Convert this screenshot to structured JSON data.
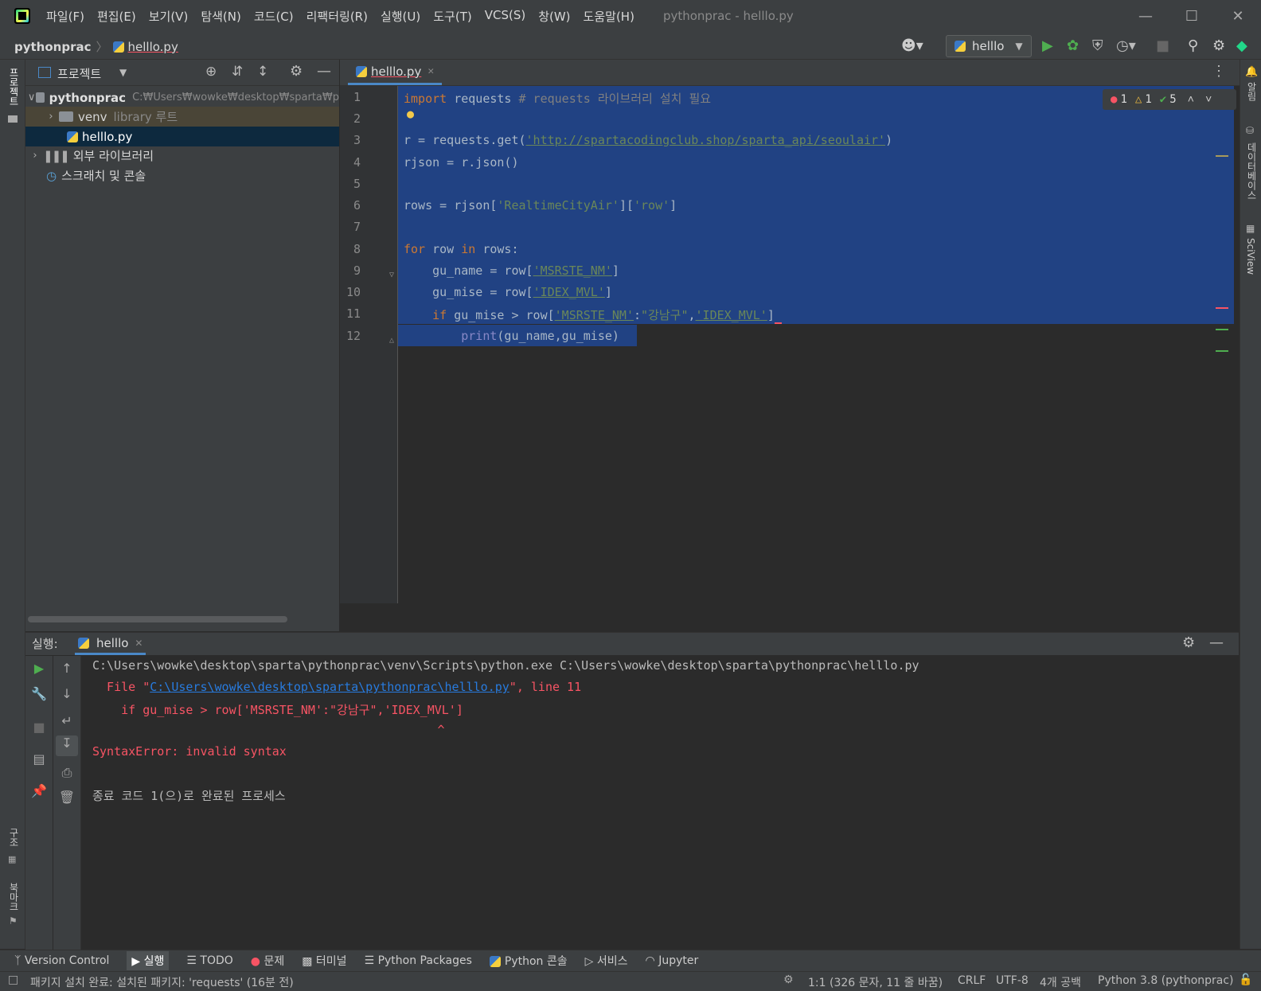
{
  "menu": [
    "파일(F)",
    "편집(E)",
    "보기(V)",
    "탐색(N)",
    "코드(C)",
    "리팩터링(R)",
    "실행(U)",
    "도구(T)",
    "VCS(S)",
    "창(W)",
    "도움말(H)"
  ],
  "window_title": "pythonprac - helllo.py",
  "breadcrumb": {
    "project": "pythonprac",
    "file": "helllo.py"
  },
  "run_config": "helllo",
  "left_stripe": {
    "project": "프로젝트",
    "structure": "구조",
    "bookmarks": "북마크"
  },
  "right_stripe": {
    "notifications": "알림",
    "database": "데이터베이스",
    "sciview": "SciView"
  },
  "project_panel": {
    "title": "프로젝트",
    "root_name": "pythonprac",
    "root_path": "C:₩Users₩wowke₩desktop₩sparta₩p",
    "venv": "venv",
    "venv_note": "library 루트",
    "file": "helllo.py",
    "external": "외부 라이브러리",
    "scratch": "스크래치 및 콘솔"
  },
  "editor": {
    "tab": "helllo.py",
    "line_numbers": [
      "1",
      "2",
      "3",
      "4",
      "5",
      "6",
      "7",
      "8",
      "9",
      "10",
      "11",
      "12"
    ],
    "inspection": {
      "errors": "1",
      "warnings": "1",
      "ok": "5"
    },
    "code": {
      "l1_kw": "import",
      "l1_mod": " requests ",
      "l1_comment": "# requests 라이브러리 설치 필요",
      "l3_a": "r = requests.get(",
      "l3_url": "'http://spartacodingclub.shop/sparta_api/seoulair'",
      "l3_b": ")",
      "l4": "rjson = r.json()",
      "l6_a": "rows = rjson[",
      "l6_s1": "'RealtimeCityAir'",
      "l6_b": "][",
      "l6_s2": "'row'",
      "l6_c": "]",
      "l8_kw1": "for",
      "l8_a": " row ",
      "l8_kw2": "in",
      "l8_b": " rows:",
      "l9_a": "    gu_name = row[",
      "l9_s": "'MSRSTE_NM'",
      "l9_b": "]",
      "l10_a": "    gu_mise = row[",
      "l10_s": "'IDEX_MVL'",
      "l10_b": "]",
      "l11_kw": "    if",
      "l11_a": " gu_mise > row[",
      "l11_s1": "'MSRSTE_NM'",
      "l11_b": ":",
      "l11_s2": "\"강남구\"",
      "l11_c": ",",
      "l11_s3": "'IDEX_MVL'",
      "l11_d": "]",
      "l12_fn": "        print",
      "l12_a": "(gu_name,gu_mise)"
    }
  },
  "run_panel": {
    "label": "실행:",
    "tab": "helllo",
    "cmd": "C:\\Users\\wowke\\desktop\\sparta\\pythonprac\\venv\\Scripts\\python.exe C:\\Users\\wowke\\desktop\\sparta\\pythonprac\\helllo.py",
    "err_file_a": "  File \"",
    "err_file_link": "C:\\Users\\wowke\\desktop\\sparta\\pythonprac\\helllo.py",
    "err_file_b": "\", line 11",
    "err_code": "    if gu_mise > row['MSRSTE_NM':\"강남구\",'IDEX_MVL']",
    "err_caret": "                                                ^",
    "err_msg": "SyntaxError: invalid syntax",
    "exit": "종료 코드 1(으)로 완료된 프로세스"
  },
  "bottom_tabs": [
    "Version Control",
    "실행",
    "TODO",
    "문제",
    "터미널",
    "Python Packages",
    "Python 콘솔",
    "서비스",
    "Jupyter"
  ],
  "status": {
    "message": "패키지 설치 완료: 설치된 패키지: 'requests' (16분 전)",
    "position": "1:1 (326 문자, 11 줄 바꿈)",
    "line_sep": "CRLF",
    "encoding": "UTF-8",
    "indent": "4개 공백",
    "interpreter": "Python 3.8 (pythonprac)"
  },
  "colors": {
    "error": "#f75464",
    "selection": "#214283",
    "link": "#287bde"
  }
}
